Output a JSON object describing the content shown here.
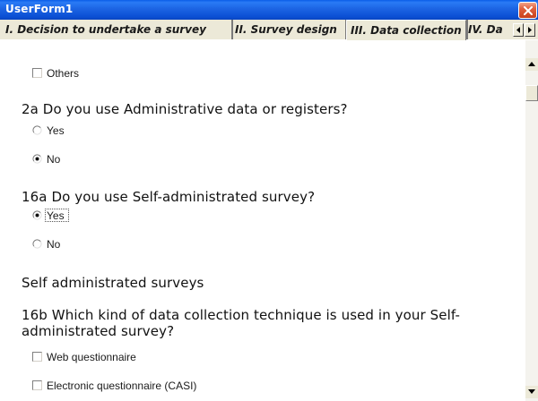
{
  "window": {
    "title": "UserForm1"
  },
  "tabs": [
    {
      "label": "I. Decision to undertake a survey"
    },
    {
      "label": "II. Survey design"
    },
    {
      "label": "III. Data collection"
    },
    {
      "label": "IV. Da"
    }
  ],
  "content": {
    "others_option": {
      "label": "Others",
      "checked": false
    },
    "q2a": {
      "text": "2a Do you use Administrative data or registers?",
      "options": [
        {
          "label": "Yes",
          "selected": false
        },
        {
          "label": "No",
          "selected": true
        }
      ]
    },
    "q16a": {
      "text": "16a Do you use Self-administrated survey?",
      "options": [
        {
          "label": "Yes",
          "selected": true
        },
        {
          "label": "No",
          "selected": false
        }
      ]
    },
    "section_heading": "Self administrated surveys",
    "q16b": {
      "text": "16b Which kind of data collection technique is used in your Self-administrated survey?",
      "options": [
        {
          "label": "Web questionnaire",
          "checked": false
        },
        {
          "label": "Electronic questionnaire (CASI)",
          "checked": false
        }
      ]
    }
  },
  "colors": {
    "titlebar": "#0b4fd4",
    "close": "#e0603c",
    "background": "#ece9d8"
  }
}
